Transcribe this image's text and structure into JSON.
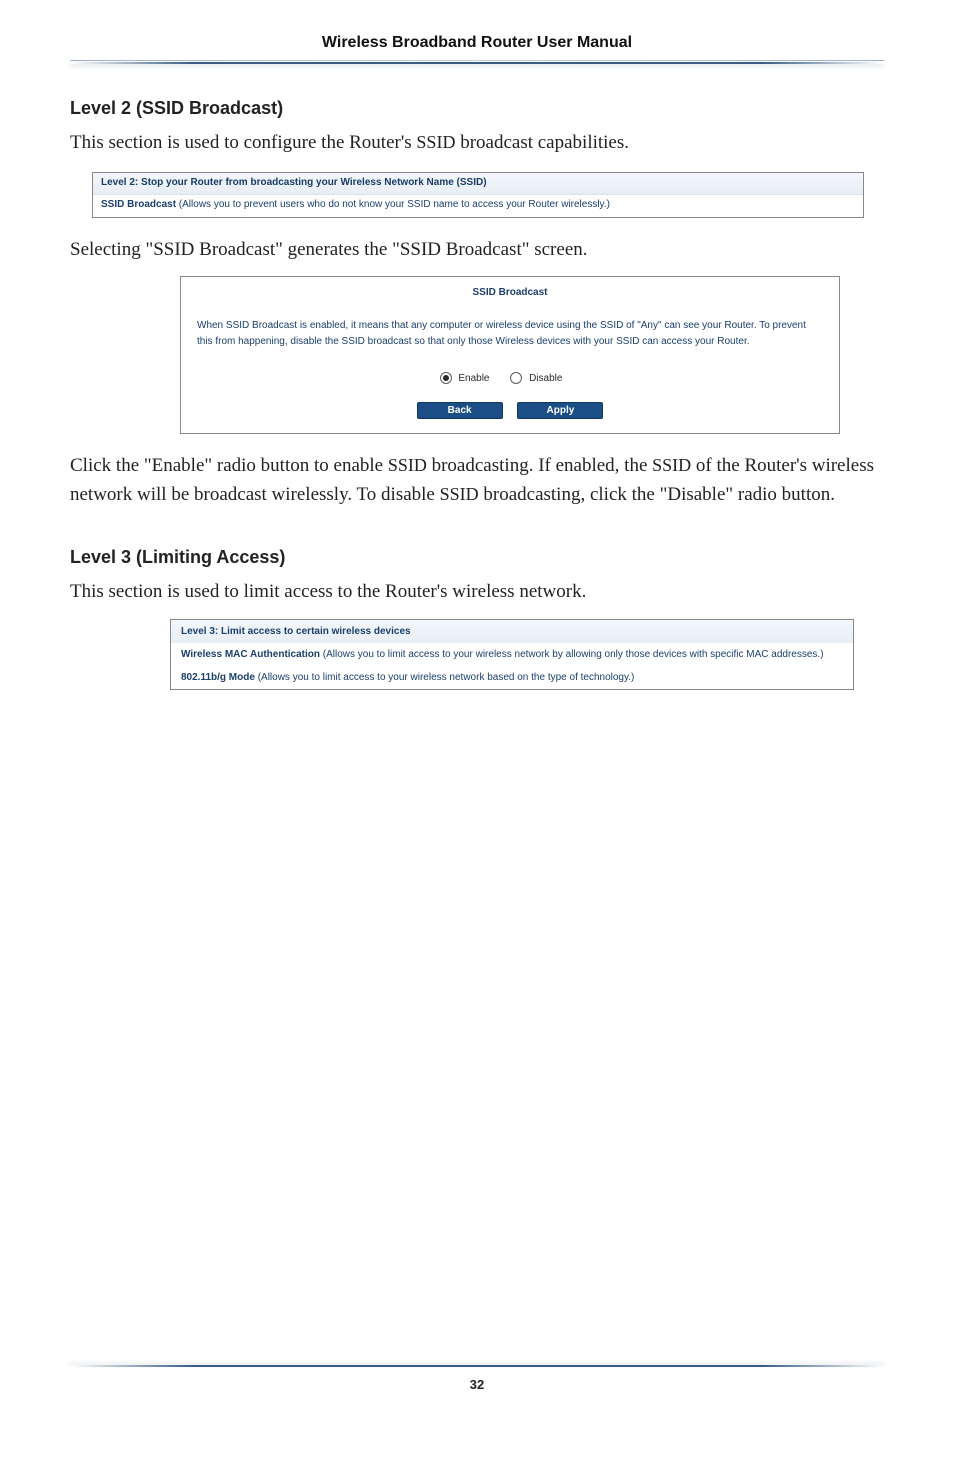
{
  "header": {
    "title": "Wireless Broadband Router User Manual"
  },
  "level2": {
    "heading": "Level 2 (SSID Broadcast)",
    "intro_prefix": "This section is used to configure the Router's ",
    "intro_smallcaps": "SSID",
    "intro_suffix": " broadcast capabilities.",
    "fig1_title": "Level 2: Stop your Router from broadcasting your Wireless Network Name (SSID)",
    "fig1_line2_bold": "SSID Broadcast",
    "fig1_line2_rest": "  (Allows you to prevent users who do not know your SSID name to access your Router wirelessly.)",
    "after_fig1": " Selecting \"SSID Broadcast\" generates the \"SSID Broadcast\" screen.",
    "dialog_title": "SSID Broadcast",
    "dialog_body": "When SSID Broadcast is enabled, it means that any computer or wireless device using the SSID of \"Any\" can see your Router. To prevent this from happening, disable the SSID broadcast so that only those Wireless devices with your SSID can access your Router.",
    "radio_enable": "Enable",
    "radio_disable": "Disable",
    "btn_back": "Back",
    "btn_apply": "Apply",
    "para_after_dialog_1_pre": "Click the \"Enable\" radio button to enable ",
    "ssid_sc_1": "SSID",
    "para_after_dialog_1_mid": " broadcasting. If enabled, the ",
    "ssid_sc_2": "SSID",
    "para_after_dialog_1_mid2": " of the Router's wireless network will be broadcast wirelessly. To disable ",
    "ssid_sc_3": "SSID",
    "para_after_dialog_1_end": " broadcasting, click the \"Disable\" radio button."
  },
  "level3": {
    "heading": "Level 3 (Limiting Access)",
    "intro": "This section is used to limit access to the Router's wireless network.",
    "row1": "Level 3: Limit access to certain wireless devices",
    "row2_bold": "Wireless MAC Authentication",
    "row2_rest": "   (Allows you to limit access to your wireless network by allowing only those devices with specific MAC addresses.)",
    "row3_bold": "802.11b/g Mode",
    "row3_rest": "  (Allows you to limit access to your wireless network based on the type of technology.)"
  },
  "footer": {
    "page_num": "32"
  }
}
